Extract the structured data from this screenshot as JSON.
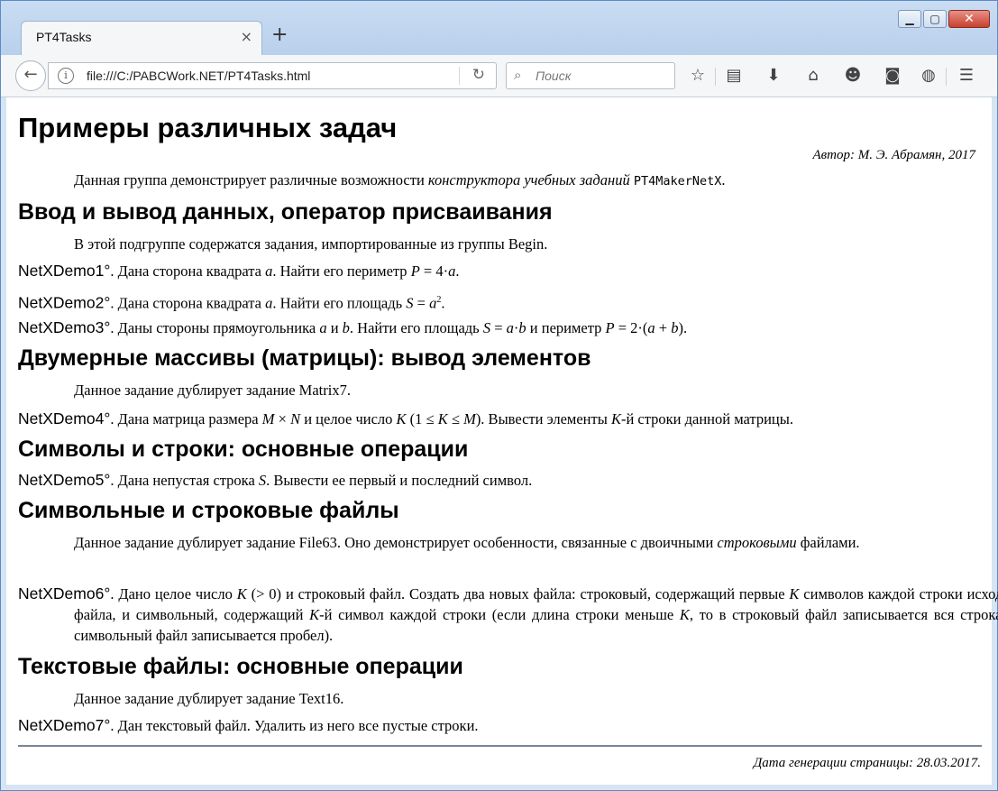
{
  "browser": {
    "tab_title": "PT4Tasks",
    "tab_close": "×",
    "new_tab": "+",
    "url": "file:///C:/PABCWork.NET/PT4Tasks.html",
    "search_placeholder": "Поиск",
    "window_controls": [
      "minimize-icon",
      "maximize-icon",
      "close-icon"
    ],
    "toolbar_icons": [
      "bookmark-star-icon",
      "reading-list-icon",
      "download-icon",
      "home-icon",
      "smiley-icon",
      "pocket-icon",
      "sync-icon",
      "menu-icon"
    ]
  },
  "page": {
    "title": "Примеры различных задач",
    "author": "Автор: М. Э. Абрамян, 2017",
    "intro_prefix": "Данная группа демонстрирует различные возможности ",
    "intro_italic": "конструктора учебных заданий",
    "intro_code": "PT4MakerNetX",
    "intro_suffix": ".",
    "sections": [
      {
        "heading": "Ввод и вывод данных, оператор присваивания",
        "note": "В этой подгруппе содержатся задания, импортированные из группы Begin."
      },
      {
        "heading": "Двумерные массивы (матрицы): вывод элементов",
        "note": "Данное задание дублирует задание Matrix7."
      },
      {
        "heading": "Символы и строки: основные операции"
      },
      {
        "heading": "Символьные и строковые файлы",
        "note_prefix": "Данное задание дублирует задание File63. Оно демонстрирует особенности, связанные с двоичными ",
        "note_italic": "строковыми",
        "note_suffix": " файлами."
      },
      {
        "heading": "Текстовые файлы: основные операции",
        "note": "Данное задание дублирует задание Text16."
      }
    ],
    "tasks": {
      "t1": "NetXDemo1°",
      "t2": "NetXDemo2°",
      "t3": "NetXDemo3°",
      "t4": "NetXDemo4°",
      "t5": "NetXDemo5°",
      "t6": "NetXDemo6°",
      "t7": "NetXDemo7°"
    },
    "footer": "Дата генерации страницы: 28.03.2017."
  }
}
